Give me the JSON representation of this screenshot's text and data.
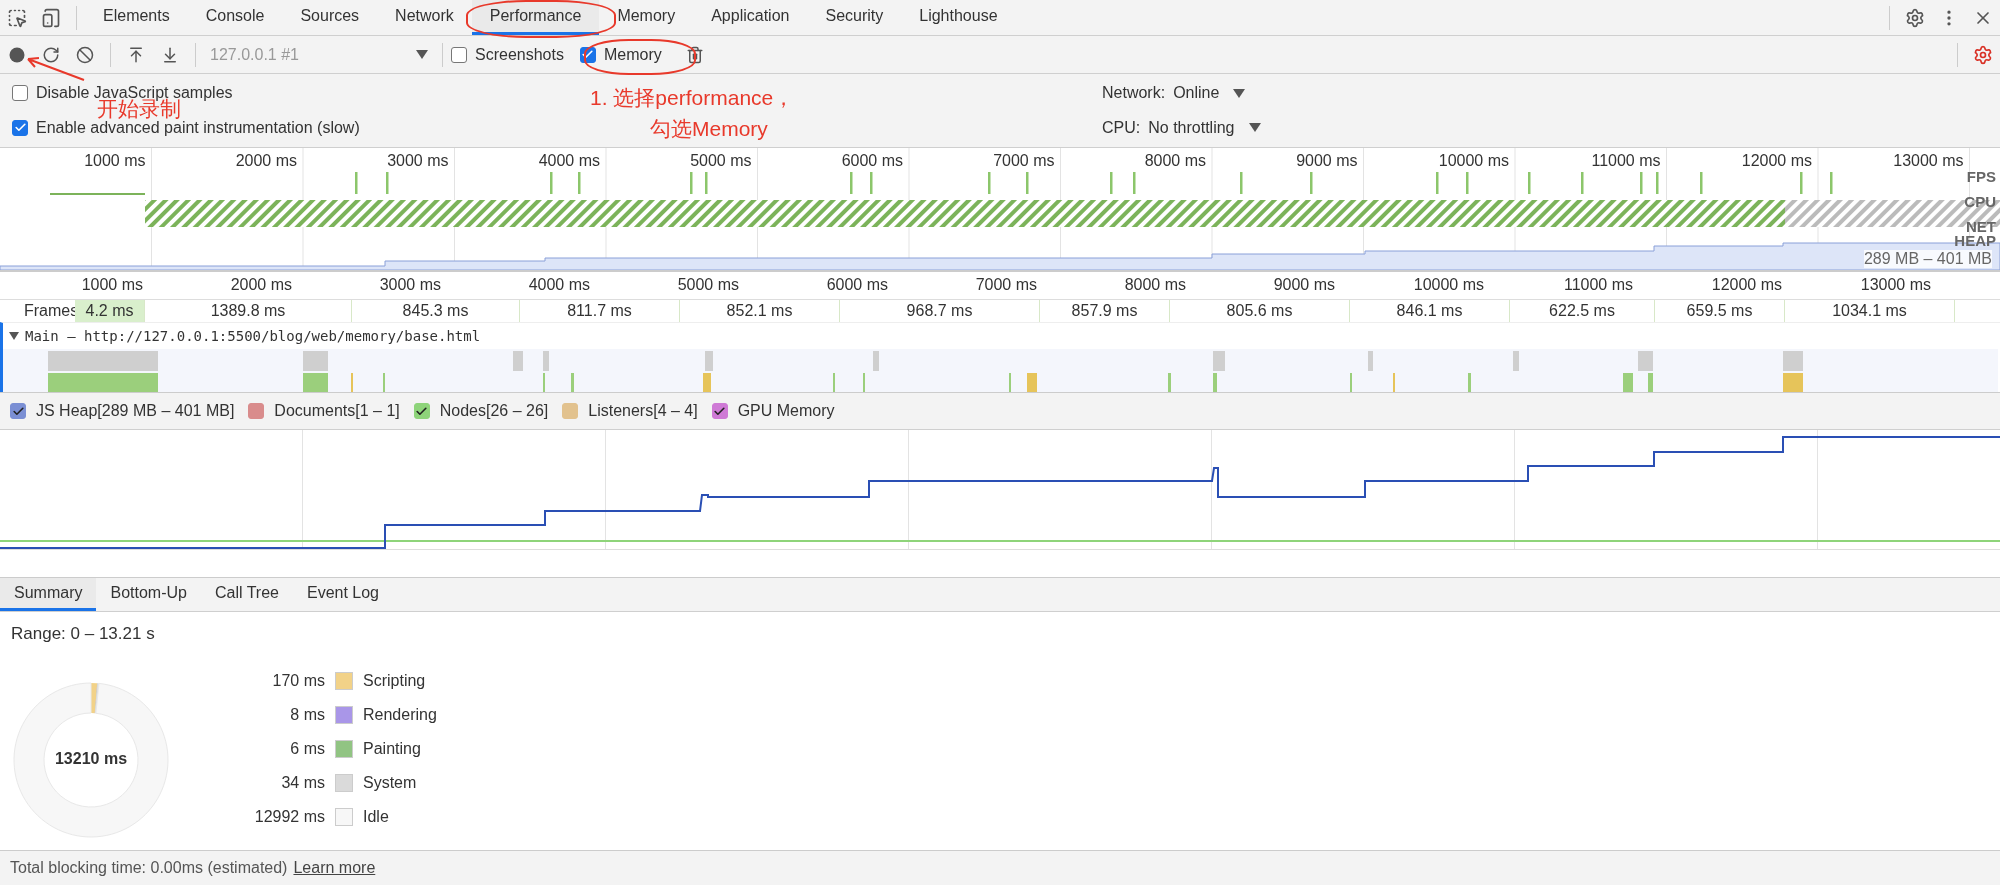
{
  "tabs": [
    {
      "label": "Elements",
      "selected": false
    },
    {
      "label": "Console",
      "selected": false
    },
    {
      "label": "Sources",
      "selected": false
    },
    {
      "label": "Network",
      "selected": false
    },
    {
      "label": "Performance",
      "selected": true
    },
    {
      "label": "Memory",
      "selected": false
    },
    {
      "label": "Application",
      "selected": false
    },
    {
      "label": "Security",
      "selected": false
    },
    {
      "label": "Lighthouse",
      "selected": false
    }
  ],
  "toolbar": {
    "target": "127.0.0.1 #1",
    "options": [
      {
        "label": "Screenshots",
        "checked": false
      },
      {
        "label": "Memory",
        "checked": true
      }
    ]
  },
  "settings": [
    {
      "label": "Disable JavaScript samples",
      "checked": false
    },
    {
      "label": "Enable advanced paint instrumentation (slow)",
      "checked": true
    }
  ],
  "throttling": [
    {
      "label": "Network:",
      "value": "Online"
    },
    {
      "label": "CPU:",
      "value": "No throttling"
    }
  ],
  "overview": {
    "ticks": [
      "1000 ms",
      "2000 ms",
      "3000 ms",
      "4000 ms",
      "5000 ms",
      "6000 ms",
      "7000 ms",
      "8000 ms",
      "9000 ms",
      "10000 ms",
      "11000 ms",
      "12000 ms",
      "13000 ms"
    ],
    "tracks": [
      "FPS",
      "CPU",
      "NET",
      "HEAP"
    ],
    "heap_range": "289 MB – 401 MB"
  },
  "timeline": {
    "ticks": [
      "1000 ms",
      "2000 ms",
      "3000 ms",
      "4000 ms",
      "5000 ms",
      "6000 ms",
      "7000 ms",
      "8000 ms",
      "9000 ms",
      "10000 ms",
      "11000 ms",
      "12000 ms",
      "13000 ms"
    ],
    "frames_label": "Frames",
    "frames": [
      "4.2 ms",
      "1389.8 ms",
      "845.3 ms",
      "811.7 ms",
      "852.1 ms",
      "968.7 ms",
      "857.9 ms",
      "805.6 ms",
      "846.1 ms",
      "622.5 ms",
      "659.5 ms",
      "1034.1 ms"
    ],
    "main_title": "Main — http://127.0.0.1:5500/blog/web/memory/base.html",
    "main_expanded": true
  },
  "counters": [
    {
      "label": "JS Heap[289 MB – 401 MB]",
      "checked": true,
      "color": "#7b8fd4"
    },
    {
      "label": "Documents[1 – 1]",
      "checked": false,
      "color": "#d98c8c"
    },
    {
      "label": "Nodes[26 – 26]",
      "checked": true,
      "color": "#8ed47a"
    },
    {
      "label": "Listeners[4 – 4]",
      "checked": false,
      "color": "#e2c28e"
    },
    {
      "label": "GPU Memory",
      "checked": true,
      "color": "#cf7ad6"
    }
  ],
  "detail_tabs": [
    {
      "label": "Summary",
      "selected": true
    },
    {
      "label": "Bottom-Up",
      "selected": false
    },
    {
      "label": "Call Tree",
      "selected": false
    },
    {
      "label": "Event Log",
      "selected": false
    }
  ],
  "summary": {
    "range": "Range: 0 – 13.21 s",
    "total": "13210 ms",
    "items": [
      {
        "value": "170 ms",
        "label": "Scripting",
        "color": "#f2d288"
      },
      {
        "value": "8 ms",
        "label": "Rendering",
        "color": "#a996e8"
      },
      {
        "value": "6 ms",
        "label": "Painting",
        "color": "#91c483"
      },
      {
        "value": "34 ms",
        "label": "System",
        "color": "#dadada"
      },
      {
        "value": "12992 ms",
        "label": "Idle",
        "color": "#f7f7f7"
      }
    ]
  },
  "footer": {
    "text": "Total blocking time: 0.00ms (estimated)",
    "link": "Learn more"
  },
  "annotations": [
    {
      "text": "开始录制"
    },
    {
      "text": "1. 选择performance，"
    },
    {
      "text": "勾选Memory"
    }
  ]
}
